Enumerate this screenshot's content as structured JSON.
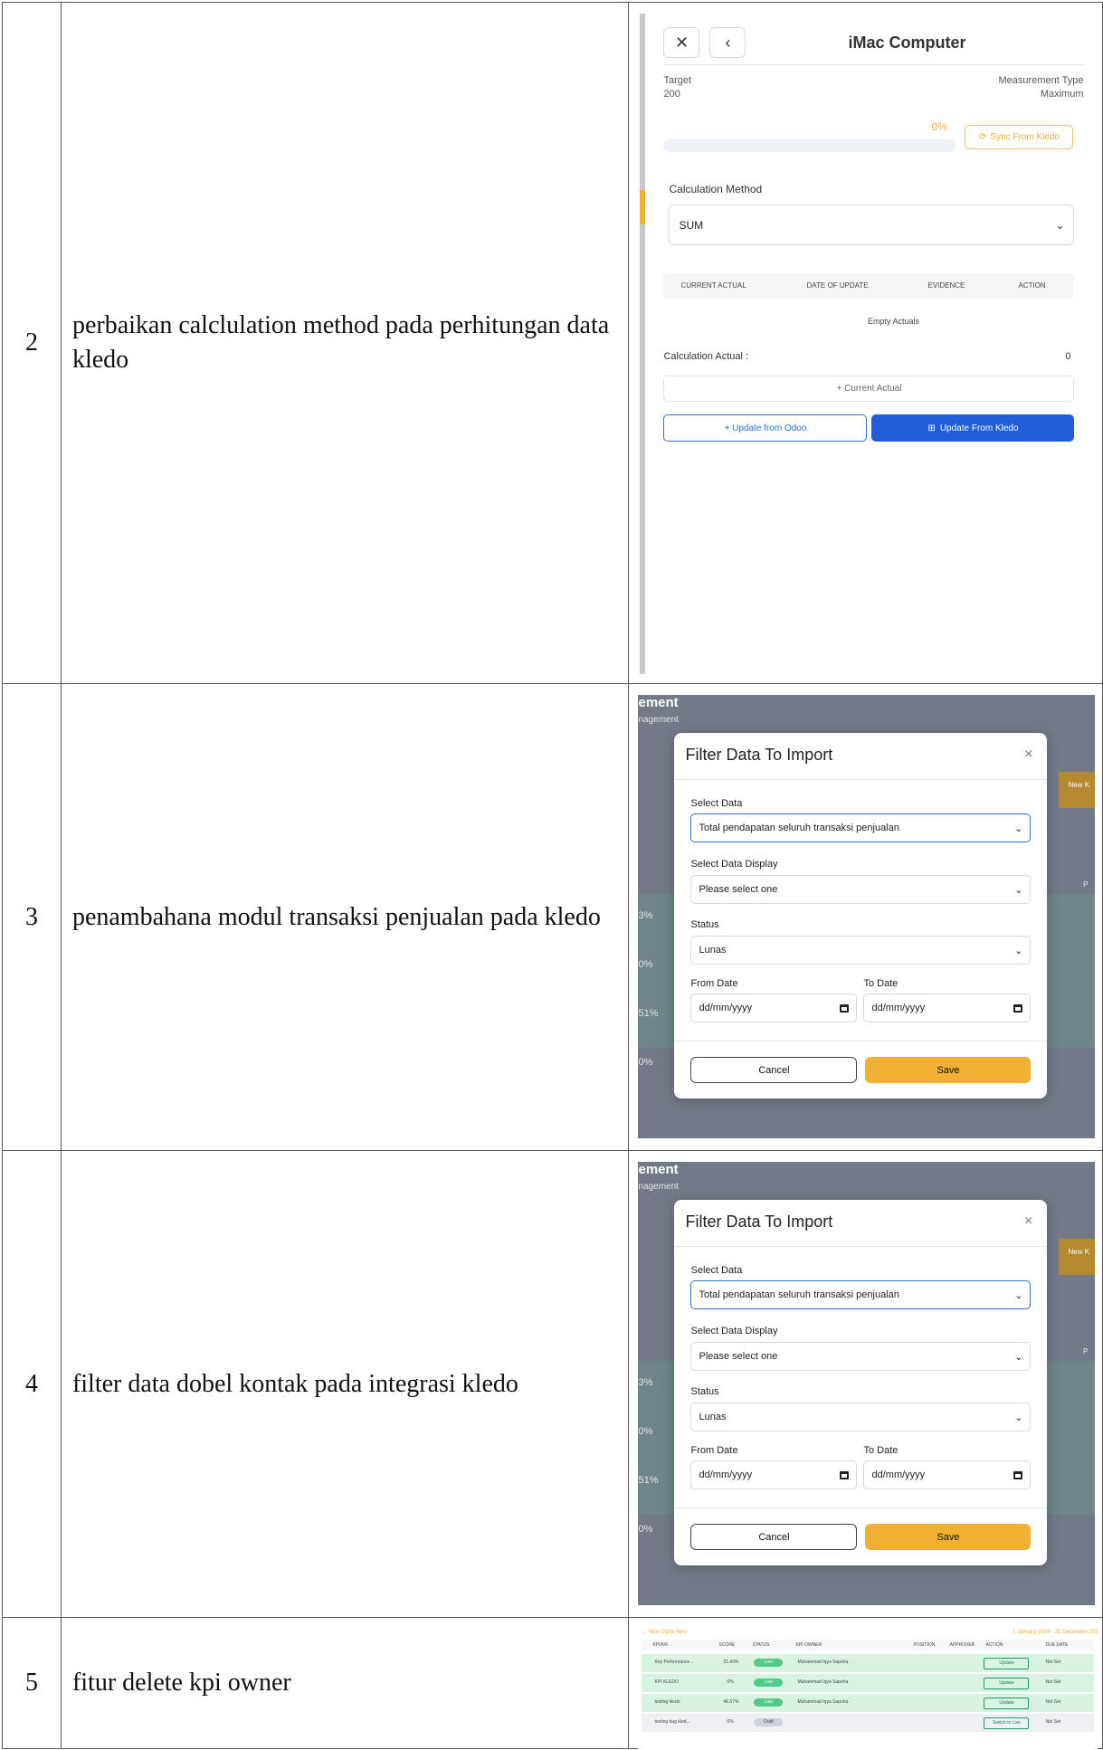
{
  "rows": [
    {
      "num": "2",
      "desc": "perbaikan calclulation method pada perhitungan data kledo"
    },
    {
      "num": "3",
      "desc": "penambahana modul transaksi penjualan pada kledo"
    },
    {
      "num": "4",
      "desc": "filter data dobel kontak pada integrasi kledo"
    },
    {
      "num": "5",
      "desc": "fitur delete kpi owner"
    }
  ],
  "panel1": {
    "title": "iMac Computer",
    "target_label": "Target",
    "target_value": "200",
    "measure_label": "Measurement Type",
    "measure_value": "Maximum",
    "progress_pct": "0%",
    "progress_value": 0,
    "sync_label": "Sync From Kledo",
    "calc_label": "Calculation Method",
    "calc_value": "SUM",
    "cols": [
      "CURRENT ACTUAL",
      "DATE OF UPDATE",
      "EVIDENCE",
      "ACTION"
    ],
    "empty": "Empty Actuals",
    "calc_actual_label": "Calculation Actual :",
    "calc_actual_value": "0",
    "current_actual": "+ Current Actual",
    "odoo": "+ Update from Odoo",
    "kledo": "Update From Kledo"
  },
  "modal": {
    "bg_title": "ement",
    "bg_sub": "nagement",
    "bg_new": "New K",
    "bg_p": "P",
    "bg_pcts": [
      "3%",
      "0%",
      "51%",
      "0%"
    ],
    "title": "Filter Data To Import",
    "close": "×",
    "select_data_label": "Select Data",
    "select_data_value": "Total pendapatan seluruh transaksi penjualan",
    "display_label": "Select Data Display",
    "display_value": "Please select one",
    "status_label": "Status",
    "status_value": "Lunas",
    "from_label": "From Date",
    "to_label": "To Date",
    "date_placeholder": "dd/mm/yyyy",
    "cancel": "Cancel",
    "save": "Save"
  },
  "kpi": {
    "new_cycle": "← New Cycle here",
    "date_range": "1 January 2024 - 31 December 202",
    "headers": [
      "KPI/KR",
      "SCORE",
      "STATUS",
      "KPI OWNER",
      "POSITION",
      "APPROVER",
      "ACTION",
      "DUE DATE"
    ],
    "rows": [
      {
        "name": "Key Performance ...",
        "score": "21.43%",
        "status": "Live",
        "owner": "Muhammad Iqya Sapoha",
        "action": "Update",
        "due": "Not Set"
      },
      {
        "name": "KPI KLEDO",
        "score": "0%",
        "status": "Live",
        "owner": "Muhammad Iqya Sapoha",
        "action": "Update",
        "due": "Not Set"
      },
      {
        "name": "testing kledo",
        "score": "46.67%",
        "status": "Live",
        "owner": "Muhammad Iqya Sapoha",
        "action": "Update",
        "due": "Not Set"
      },
      {
        "name": "testing bug kled...",
        "score": "0%",
        "status": "Draft",
        "owner": "",
        "action": "Switch to Live",
        "due": "Not Set"
      }
    ]
  }
}
